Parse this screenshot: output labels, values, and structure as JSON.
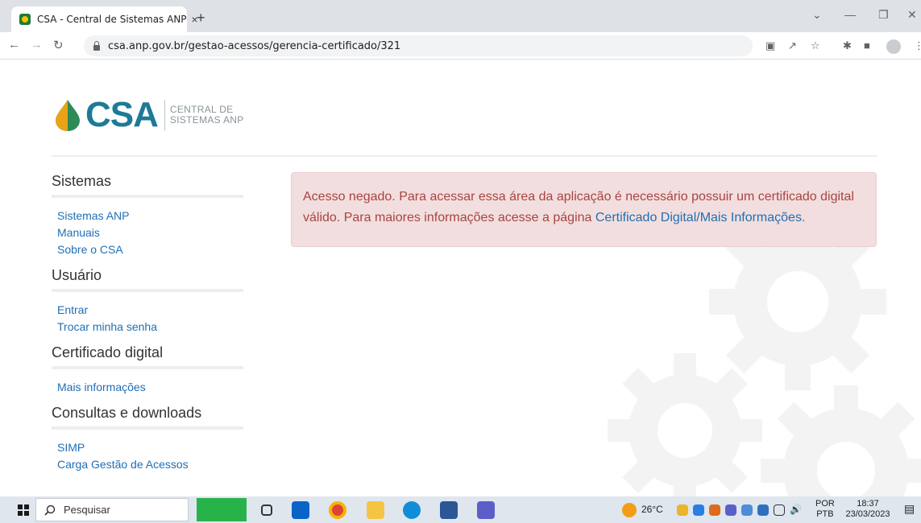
{
  "browser": {
    "tab_title": "CSA - Central de Sistemas ANP",
    "tab_close": "×",
    "new_tab": "+",
    "url": "csa.anp.gov.br/gestao-acessos/gerencia-certificado/321"
  },
  "logo": {
    "text": "CSA",
    "subtitle_line1": "CENTRAL DE",
    "subtitle_line2": "SISTEMAS ANP"
  },
  "sidebar": {
    "sections": [
      {
        "title": "Sistemas",
        "links": [
          "Sistemas ANP",
          "Manuais",
          "Sobre o CSA"
        ]
      },
      {
        "title": "Usuário",
        "links": [
          "Entrar",
          "Trocar minha senha"
        ]
      },
      {
        "title": "Certificado digital",
        "links": [
          "Mais informações"
        ]
      },
      {
        "title": "Consultas e downloads",
        "links": [
          "SIMP",
          "Carga Gestão de Acessos"
        ]
      }
    ]
  },
  "alert": {
    "text": "Acesso negado. Para acessar essa área da aplicação é necessário possuir um certificado digital válido. Para maiores informações acesse a página ",
    "link": "Certificado Digital/Mais Informações",
    "suffix": "."
  },
  "taskbar": {
    "search_placeholder": "Pesquisar",
    "weather": "26°C",
    "lang_line1": "POR",
    "lang_line2": "PTB",
    "time": "18:37",
    "date": "23/03/2023"
  },
  "colors": {
    "link": "#1f6fb5",
    "alert_bg": "#f2dede",
    "alert_text": "#a94442",
    "brand": "#1e7a96"
  }
}
